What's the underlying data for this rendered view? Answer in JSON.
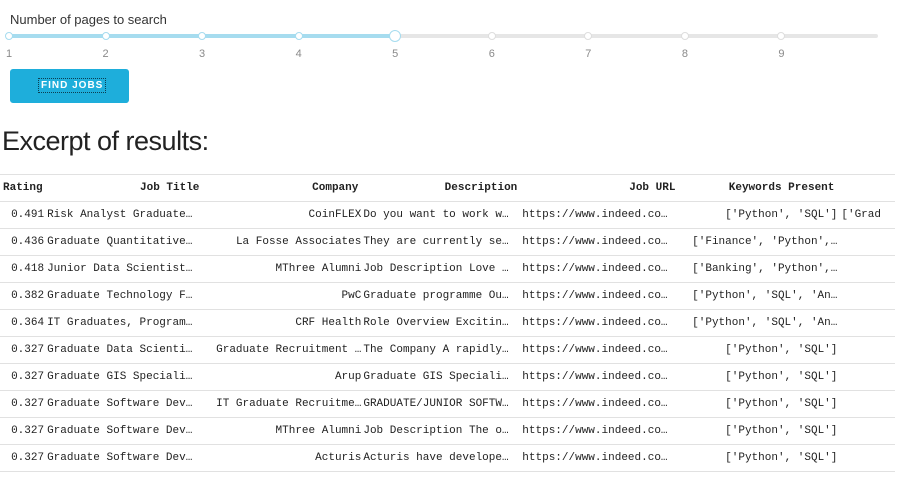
{
  "slider": {
    "label": "Number of pages to search",
    "min": 1,
    "max": 10,
    "value": 5,
    "tick_labels": [
      "1",
      "2",
      "3",
      "4",
      "5",
      "6",
      "7",
      "8",
      "9"
    ],
    "colors": {
      "track": "#e6e6e6",
      "fill": "#a6dcef"
    }
  },
  "find_button": {
    "label": "FIND JOBS",
    "color": "#1eaedb"
  },
  "results": {
    "heading": "Excerpt of results:",
    "columns": [
      "Rating",
      "Job Title",
      "Company",
      "Description",
      "Job URL",
      "Keywords Present"
    ],
    "rows": [
      [
        "0.491",
        "Risk Analyst Graduate…",
        "CoinFLEX",
        "Do you want to work w…",
        "https://www.indeed.co…",
        "['Python', 'SQL']",
        "['Grad"
      ],
      [
        "0.436",
        "Graduate Quantitative…",
        "La Fosse Associates",
        "They are currently se…",
        "https://www.indeed.co…",
        "['Finance', 'Python',…",
        ""
      ],
      [
        "0.418",
        "Junior Data Scientist…",
        "MThree Alumni",
        "Job Description Love …",
        "https://www.indeed.co…",
        "['Banking', 'Python',…",
        ""
      ],
      [
        "0.382",
        "Graduate Technology F…",
        "PwC",
        "Graduate programme Ou…",
        "https://www.indeed.co…",
        "['Python', 'SQL', 'An…",
        ""
      ],
      [
        "0.364",
        "IT Graduates, Program…",
        "CRF Health",
        "Role Overview Excitin…",
        "https://www.indeed.co…",
        "['Python', 'SQL', 'An…",
        ""
      ],
      [
        "0.327",
        "Graduate Data Scienti…",
        "Graduate Recruitment …",
        "The Company A rapidly…",
        "https://www.indeed.co…",
        "['Python', 'SQL']",
        ""
      ],
      [
        "0.327",
        "Graduate GIS Speciali…",
        "Arup",
        "Graduate GIS Speciali…",
        "https://www.indeed.co…",
        "['Python', 'SQL']",
        ""
      ],
      [
        "0.327",
        "Graduate Software Dev…",
        "IT Graduate Recruitme…",
        "GRADUATE/JUNIOR SOFTW…",
        "https://www.indeed.co…",
        "['Python', 'SQL']",
        ""
      ],
      [
        "0.327",
        "Graduate Software Dev…",
        "MThree Alumni",
        "Job Description The o…",
        "https://www.indeed.co…",
        "['Python', 'SQL']",
        ""
      ],
      [
        "0.327",
        "Graduate Software Dev…",
        "Acturis",
        "Acturis have develope…",
        "https://www.indeed.co…",
        "['Python', 'SQL']",
        ""
      ]
    ]
  }
}
